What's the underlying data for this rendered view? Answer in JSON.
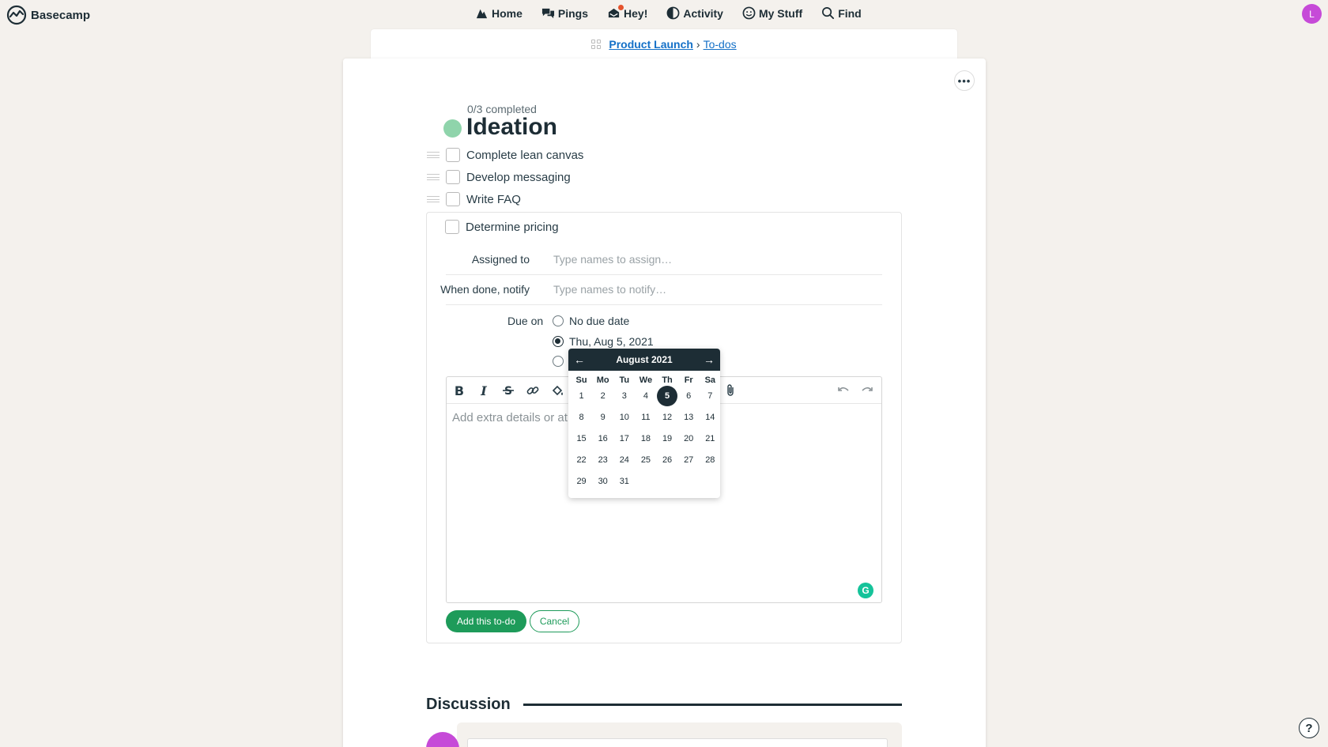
{
  "app": {
    "name": "Basecamp",
    "user_initial": "L"
  },
  "nav": [
    {
      "label": "Home",
      "icon": "home-icon"
    },
    {
      "label": "Pings",
      "icon": "pings-icon"
    },
    {
      "label": "Hey!",
      "icon": "hey-icon"
    },
    {
      "label": "Activity",
      "icon": "activity-icon"
    },
    {
      "label": "My Stuff",
      "icon": "my-stuff-icon"
    },
    {
      "label": "Find",
      "icon": "search-icon"
    }
  ],
  "breadcrumb": {
    "project": "Product Launch",
    "separator": "›",
    "section": "To-dos"
  },
  "list": {
    "completed": "0/3 completed",
    "title": "Ideation",
    "color": "#8fd4ab",
    "todos": [
      "Complete lean canvas",
      "Develop messaging",
      "Write FAQ"
    ]
  },
  "new_todo": {
    "title": "Determine pricing",
    "assigned_label": "Assigned to",
    "assigned_placeholder": "Type names to assign…",
    "notify_label": "When done, notify",
    "notify_placeholder": "Type names to notify…",
    "due_label": "Due on",
    "due_options": [
      "No due date",
      "Thu, Aug 5, 2021",
      ""
    ],
    "due_selected_index": 1,
    "notes_placeholder": "Add extra details or at",
    "add_button": "Add this to-do",
    "cancel_button": "Cancel"
  },
  "calendar": {
    "month": "August 2021",
    "prev": "←",
    "next": "→",
    "weekdays": [
      "Su",
      "Mo",
      "Tu",
      "We",
      "Th",
      "Fr",
      "Sa"
    ],
    "days": [
      "1",
      "2",
      "3",
      "4",
      "5",
      "6",
      "7",
      "8",
      "9",
      "10",
      "11",
      "12",
      "13",
      "14",
      "15",
      "16",
      "17",
      "18",
      "19",
      "20",
      "21",
      "22",
      "23",
      "24",
      "25",
      "26",
      "27",
      "28",
      "29",
      "30",
      "31"
    ],
    "selected_day": "5"
  },
  "discussion": {
    "title": "Discussion"
  },
  "help": "?",
  "colors": {
    "accent_green": "#1e9b5a",
    "dark": "#1d2d35",
    "link": "#1470c7",
    "avatar": "#c64ad8"
  }
}
